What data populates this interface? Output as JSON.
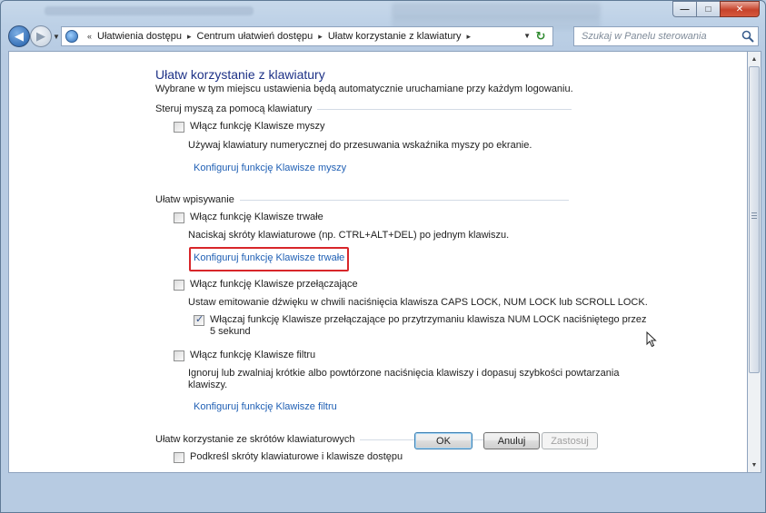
{
  "title_bar": {
    "buttons": {
      "minimize": "—",
      "maximize": "□",
      "close": "✕"
    }
  },
  "nav": {
    "overflow": "«",
    "breadcrumbs": [
      "Ułatwienia dostępu",
      "Centrum ułatwień dostępu",
      "Ułatw korzystanie z klawiatury"
    ],
    "separator": "▸",
    "search_placeholder": "Szukaj w Panelu sterowania"
  },
  "page": {
    "title": "Ułatw korzystanie z klawiatury",
    "subtitle": "Wybrane w tym miejscu ustawienia będą automatycznie uruchamiane przy każdym logowaniu."
  },
  "sections": {
    "mouse": {
      "header": "Steruj myszą za pomocą klawiatury",
      "checkbox_label": "Włącz funkcję Klawisze myszy",
      "checked": false,
      "description": "Używaj klawiatury numerycznej do przesuwania wskaźnika myszy po ekranie.",
      "link": "Konfiguruj funkcję Klawisze myszy"
    },
    "typing": {
      "header": "Ułatw wpisywanie",
      "sticky": {
        "checkbox_label": "Włącz funkcję Klawisze trwałe",
        "checked": false,
        "description": "Naciskaj skróty klawiaturowe (np. CTRL+ALT+DEL) po jednym klawiszu.",
        "link": "Konfiguruj funkcję Klawisze trwałe"
      },
      "toggle": {
        "checkbox_label": "Włącz funkcję Klawisze przełączające",
        "checked": false,
        "description": "Ustaw emitowanie dźwięku w chwili naciśnięcia klawisza CAPS LOCK, NUM LOCK lub SCROLL LOCK.",
        "sub_checkbox_label_line1": "Włączaj funkcję Klawisze przełączające po przytrzymaniu klawisza NUM LOCK naciśniętego przez",
        "sub_checkbox_label_line2": "5 sekund",
        "sub_checked": true
      },
      "filter": {
        "checkbox_label": "Włącz funkcję Klawisze filtru",
        "checked": false,
        "description_line1": "Ignoruj lub zwalniaj krótkie albo powtórzone naciśnięcia klawiszy i dopasuj szybkości powtarzania",
        "description_line2": "klawiszy.",
        "link": "Konfiguruj funkcję Klawisze filtru"
      }
    },
    "shortcuts": {
      "header": "Ułatw korzystanie ze skrótów klawiaturowych",
      "checkbox_label": "Podkreśl skróty klawiaturowe i klawisze dostępu",
      "checked": false
    }
  },
  "buttons": {
    "ok": "OK",
    "cancel": "Anuluj",
    "apply": "Zastosuj"
  },
  "colors": {
    "link": "#1f5fb4",
    "title": "#1e3287",
    "highlight_box": "#d8262a"
  }
}
